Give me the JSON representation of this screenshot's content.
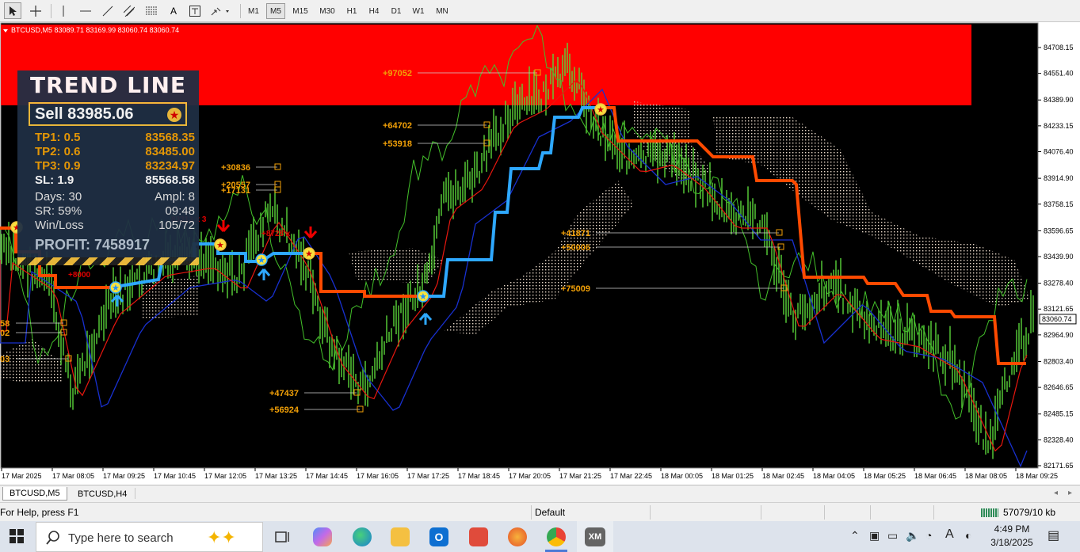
{
  "toolbar": {
    "tools": [
      "cursor",
      "crosshair",
      "vertical-line",
      "horizontal-line",
      "trendline",
      "equidistant-channel",
      "fibonacci",
      "text",
      "text-label",
      "arrows"
    ],
    "timeframes": [
      "M1",
      "M5",
      "M15",
      "M30",
      "H1",
      "H4",
      "D1",
      "W1",
      "MN"
    ],
    "active_timeframe": "M5"
  },
  "chart": {
    "header": "BTCUSD,M5  83089.71 83169.99 83060.74 83060.74",
    "current_price": "83060.74",
    "price_labels": [
      "84708.15",
      "84551.40",
      "84389.90",
      "84233.15",
      "84076.40",
      "83914.90",
      "83758.15",
      "83596.65",
      "83439.90",
      "83278.40",
      "83121.65",
      "82964.90",
      "82803.40",
      "82646.65",
      "82485.15",
      "82328.40",
      "82171.65"
    ],
    "time_labels": [
      "17 Mar 2025",
      "17 Mar 08:05",
      "17 Mar 09:25",
      "17 Mar 10:45",
      "17 Mar 12:05",
      "17 Mar 13:25",
      "17 Mar 14:45",
      "17 Mar 16:05",
      "17 Mar 17:25",
      "17 Mar 18:45",
      "17 Mar 20:05",
      "17 Mar 21:25",
      "17 Mar 22:45",
      "18 Mar 00:05",
      "18 Mar 01:25",
      "18 Mar 02:45",
      "18 Mar 04:05",
      "18 Mar 05:25",
      "18 Mar 06:45",
      "18 Mar 08:05",
      "18 Mar 09:25"
    ],
    "annotations": [
      "+97052",
      "+64702",
      "+53918",
      "+30836",
      "+20557",
      "+17131",
      "+41871",
      "+50006",
      "+75009",
      "+47437",
      "+56924",
      "58",
      "02",
      "03",
      "83313 x 3",
      "+8728 x",
      "+8000"
    ],
    "colors": {
      "resistance_zone": "#ff0000",
      "price": "#5ad53a",
      "trend_up": "#2ea8ff",
      "trend_down": "#ff4a00",
      "ma_red": "#e8170f",
      "ma_blue": "#1830d0",
      "label": "#f2a007"
    }
  },
  "panel": {
    "title": "TREND LINE",
    "signal": "Sell  83985.06",
    "tp1_label": "TP1: 0.5",
    "tp1_value": "83568.35",
    "tp2_label": "TP2: 0.6",
    "tp2_value": "83485.00",
    "tp3_label": "TP3: 0.9",
    "tp3_value": "83234.97",
    "sl_label": "SL: 1.9",
    "sl_value": "85568.58",
    "days": "Days: 30",
    "ampl": "Ampl: 8",
    "sr": "SR:  59%",
    "time": "09:48",
    "winloss_label": "Win/Loss",
    "winloss_value": "105/72",
    "profit": "PROFIT: 7458917"
  },
  "tabs": [
    "BTCUSD,M5",
    "BTCUSD,H4"
  ],
  "status": {
    "help": "For Help, press F1",
    "profile": "Default",
    "traffic": "57079/10 kb"
  },
  "taskbar": {
    "search_placeholder": "Type here to search",
    "time": "4:49 PM",
    "date": "3/18/2025"
  }
}
